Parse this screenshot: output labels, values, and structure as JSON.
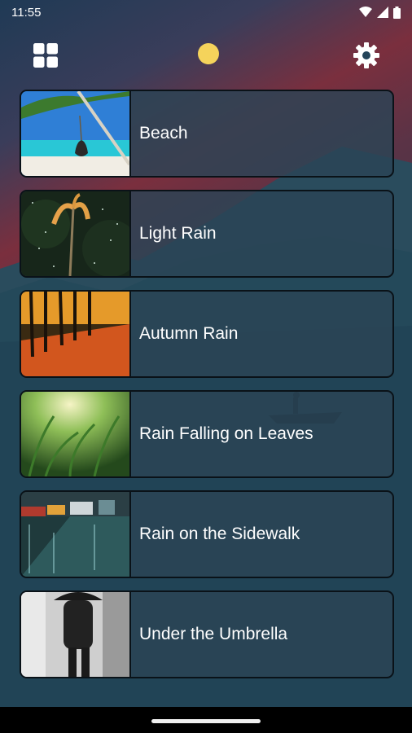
{
  "status_bar": {
    "time": "11:55",
    "icons": [
      "wifi-icon",
      "signal-icon",
      "battery-icon"
    ]
  },
  "toolbar": {
    "left_icon": "grid-icon",
    "center_icon": "sun-icon",
    "right_icon": "gear-icon"
  },
  "sounds": [
    {
      "title": "Beach",
      "thumbnail": "beach-hammock-thumbnail"
    },
    {
      "title": "Light Rain",
      "thumbnail": "light-rain-palm-thumbnail"
    },
    {
      "title": "Autumn Rain",
      "thumbnail": "autumn-forest-thumbnail"
    },
    {
      "title": "Rain Falling on Leaves",
      "thumbnail": "grass-raindrops-thumbnail"
    },
    {
      "title": "Rain on the Sidewalk",
      "thumbnail": "rainy-street-thumbnail"
    },
    {
      "title": "Under the Umbrella",
      "thumbnail": "umbrella-walker-thumbnail"
    }
  ],
  "colors": {
    "sun": "#f5d35b",
    "card_bg": "#2b4456",
    "background_top": "#1e3346",
    "background_red": "#7b2e3a"
  }
}
